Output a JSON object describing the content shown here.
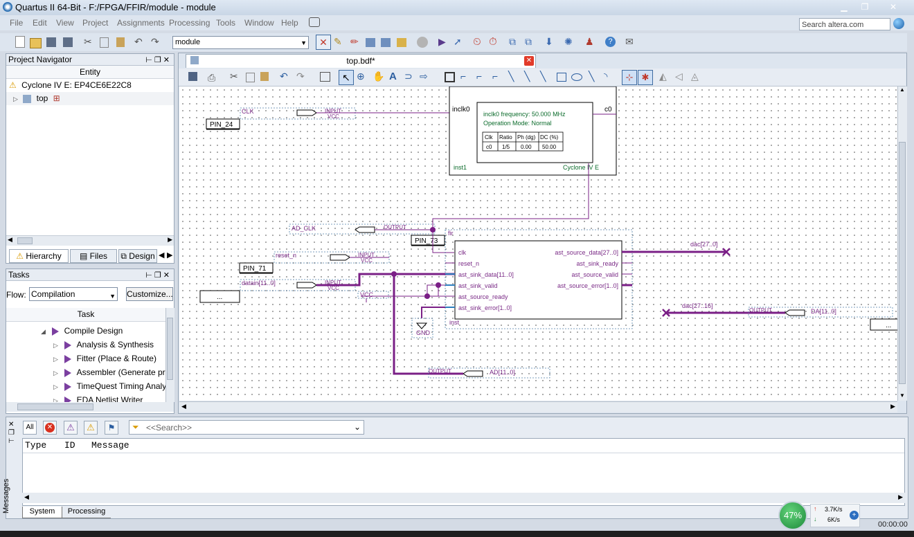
{
  "window": {
    "title": "Quartus II 64-Bit - F:/FPGA/FFIR/module - module"
  },
  "menu": [
    "File",
    "Edit",
    "View",
    "Project",
    "Assignments",
    "Processing",
    "Tools",
    "Window",
    "Help"
  ],
  "search": {
    "placeholder": "Search altera.com"
  },
  "toolbar": {
    "entity_value": "module"
  },
  "navigator": {
    "title": "Project Navigator",
    "column": "Entity",
    "device": "Cyclone IV E: EP4CE6E22C8",
    "top": "top",
    "tabs": [
      "Hierarchy",
      "Files",
      "Design"
    ]
  },
  "tasks": {
    "title": "Tasks",
    "flow_label": "Flow:",
    "flow_value": "Compilation",
    "customize": "Customize...",
    "column": "Task",
    "items": [
      "Compile Design",
      "Analysis & Synthesis",
      "Fitter (Place & Route)",
      "Assembler (Generate prog",
      "TimeQuest Timing Analysis",
      "EDA Netlist Writer"
    ]
  },
  "editor": {
    "tab": "top.bdf*"
  },
  "schematic": {
    "pin_clk": "PIN_24",
    "clk": "CLK",
    "input": "INPUT",
    "vcc": "VCC",
    "pll": {
      "inclk": "inclk0",
      "c0": "c0",
      "freq": "inclk0 frequency: 50.000 MHz",
      "mode": "Operation Mode: Normal",
      "th": [
        "Clk",
        "Ratio",
        "Ph (dg)",
        "DC (%)"
      ],
      "tr": [
        "c0",
        "1/5",
        "0.00",
        "50.00"
      ],
      "inst": "inst1",
      "family": "Cyclone IV E"
    },
    "adclk": "AD_CLK",
    "output": "OUTPUT",
    "pin73": "PIN_73",
    "fir": {
      "title": "fir",
      "inst": "inst",
      "left_ports": [
        "clk",
        "reset_n",
        "ast_sink_data[11..0]",
        "ast_sink_valid",
        "ast_source_ready",
        "ast_sink_error[1..0]"
      ],
      "right_ports": [
        "ast_source_data[27..0]",
        "ast_sink_ready",
        "ast_source_valid",
        "ast_source_error[1..0]"
      ]
    },
    "reset": "reset_n",
    "pin71": "PIN_71",
    "datain": "datain[11..0]",
    "ellipsis": "...",
    "gnd": "GND",
    "dac_out": "dac[27..0]",
    "dac_in": "dac[27..16]",
    "da": "DA[11..0]",
    "ad": "AD[11..0]"
  },
  "messages": {
    "all": "All",
    "search_placeholder": "<<Search>>",
    "columns": [
      "Type",
      "ID",
      "Message"
    ],
    "tabs": [
      "System",
      "Processing"
    ],
    "side_label": "Messages"
  },
  "netmon": {
    "percent": "47%",
    "up": "3.7K/s",
    "down": "6K/s",
    "time": "00:00:00"
  },
  "colors": {
    "wire": "#7a1f86",
    "bus": "#7a1f86",
    "accent": "#1b5fa8"
  }
}
